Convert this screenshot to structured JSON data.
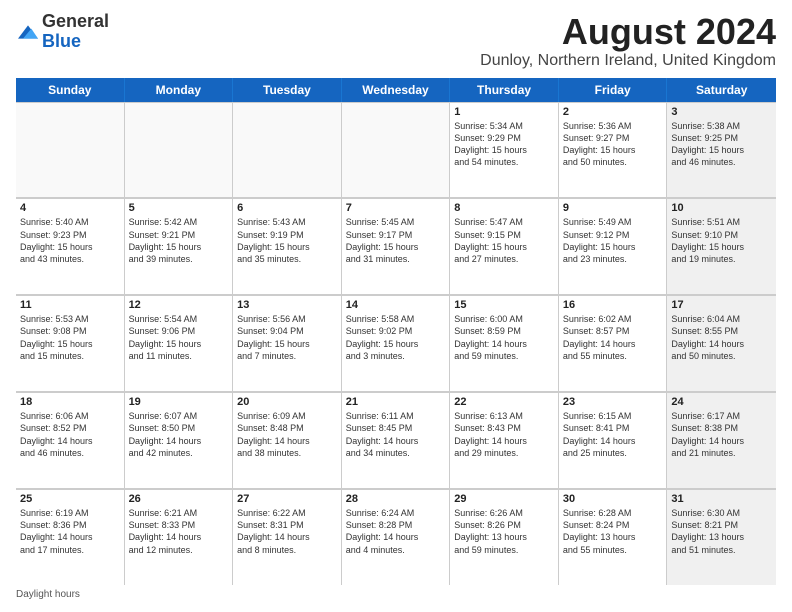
{
  "header": {
    "logo_line1": "General",
    "logo_line2": "Blue",
    "title": "August 2024",
    "subtitle": "Dunloy, Northern Ireland, United Kingdom"
  },
  "days_of_week": [
    "Sunday",
    "Monday",
    "Tuesday",
    "Wednesday",
    "Thursday",
    "Friday",
    "Saturday"
  ],
  "rows": [
    {
      "cells": [
        {
          "day": "",
          "info": "",
          "empty": true
        },
        {
          "day": "",
          "info": "",
          "empty": true
        },
        {
          "day": "",
          "info": "",
          "empty": true
        },
        {
          "day": "",
          "info": "",
          "empty": true
        },
        {
          "day": "1",
          "info": "Sunrise: 5:34 AM\nSunset: 9:29 PM\nDaylight: 15 hours\nand 54 minutes.",
          "empty": false
        },
        {
          "day": "2",
          "info": "Sunrise: 5:36 AM\nSunset: 9:27 PM\nDaylight: 15 hours\nand 50 minutes.",
          "empty": false
        },
        {
          "day": "3",
          "info": "Sunrise: 5:38 AM\nSunset: 9:25 PM\nDaylight: 15 hours\nand 46 minutes.",
          "empty": false,
          "shaded": true
        }
      ]
    },
    {
      "cells": [
        {
          "day": "4",
          "info": "Sunrise: 5:40 AM\nSunset: 9:23 PM\nDaylight: 15 hours\nand 43 minutes.",
          "empty": false
        },
        {
          "day": "5",
          "info": "Sunrise: 5:42 AM\nSunset: 9:21 PM\nDaylight: 15 hours\nand 39 minutes.",
          "empty": false
        },
        {
          "day": "6",
          "info": "Sunrise: 5:43 AM\nSunset: 9:19 PM\nDaylight: 15 hours\nand 35 minutes.",
          "empty": false
        },
        {
          "day": "7",
          "info": "Sunrise: 5:45 AM\nSunset: 9:17 PM\nDaylight: 15 hours\nand 31 minutes.",
          "empty": false
        },
        {
          "day": "8",
          "info": "Sunrise: 5:47 AM\nSunset: 9:15 PM\nDaylight: 15 hours\nand 27 minutes.",
          "empty": false
        },
        {
          "day": "9",
          "info": "Sunrise: 5:49 AM\nSunset: 9:12 PM\nDaylight: 15 hours\nand 23 minutes.",
          "empty": false
        },
        {
          "day": "10",
          "info": "Sunrise: 5:51 AM\nSunset: 9:10 PM\nDaylight: 15 hours\nand 19 minutes.",
          "empty": false,
          "shaded": true
        }
      ]
    },
    {
      "cells": [
        {
          "day": "11",
          "info": "Sunrise: 5:53 AM\nSunset: 9:08 PM\nDaylight: 15 hours\nand 15 minutes.",
          "empty": false
        },
        {
          "day": "12",
          "info": "Sunrise: 5:54 AM\nSunset: 9:06 PM\nDaylight: 15 hours\nand 11 minutes.",
          "empty": false
        },
        {
          "day": "13",
          "info": "Sunrise: 5:56 AM\nSunset: 9:04 PM\nDaylight: 15 hours\nand 7 minutes.",
          "empty": false
        },
        {
          "day": "14",
          "info": "Sunrise: 5:58 AM\nSunset: 9:02 PM\nDaylight: 15 hours\nand 3 minutes.",
          "empty": false
        },
        {
          "day": "15",
          "info": "Sunrise: 6:00 AM\nSunset: 8:59 PM\nDaylight: 14 hours\nand 59 minutes.",
          "empty": false
        },
        {
          "day": "16",
          "info": "Sunrise: 6:02 AM\nSunset: 8:57 PM\nDaylight: 14 hours\nand 55 minutes.",
          "empty": false
        },
        {
          "day": "17",
          "info": "Sunrise: 6:04 AM\nSunset: 8:55 PM\nDaylight: 14 hours\nand 50 minutes.",
          "empty": false,
          "shaded": true
        }
      ]
    },
    {
      "cells": [
        {
          "day": "18",
          "info": "Sunrise: 6:06 AM\nSunset: 8:52 PM\nDaylight: 14 hours\nand 46 minutes.",
          "empty": false
        },
        {
          "day": "19",
          "info": "Sunrise: 6:07 AM\nSunset: 8:50 PM\nDaylight: 14 hours\nand 42 minutes.",
          "empty": false
        },
        {
          "day": "20",
          "info": "Sunrise: 6:09 AM\nSunset: 8:48 PM\nDaylight: 14 hours\nand 38 minutes.",
          "empty": false
        },
        {
          "day": "21",
          "info": "Sunrise: 6:11 AM\nSunset: 8:45 PM\nDaylight: 14 hours\nand 34 minutes.",
          "empty": false
        },
        {
          "day": "22",
          "info": "Sunrise: 6:13 AM\nSunset: 8:43 PM\nDaylight: 14 hours\nand 29 minutes.",
          "empty": false
        },
        {
          "day": "23",
          "info": "Sunrise: 6:15 AM\nSunset: 8:41 PM\nDaylight: 14 hours\nand 25 minutes.",
          "empty": false
        },
        {
          "day": "24",
          "info": "Sunrise: 6:17 AM\nSunset: 8:38 PM\nDaylight: 14 hours\nand 21 minutes.",
          "empty": false,
          "shaded": true
        }
      ]
    },
    {
      "cells": [
        {
          "day": "25",
          "info": "Sunrise: 6:19 AM\nSunset: 8:36 PM\nDaylight: 14 hours\nand 17 minutes.",
          "empty": false
        },
        {
          "day": "26",
          "info": "Sunrise: 6:21 AM\nSunset: 8:33 PM\nDaylight: 14 hours\nand 12 minutes.",
          "empty": false
        },
        {
          "day": "27",
          "info": "Sunrise: 6:22 AM\nSunset: 8:31 PM\nDaylight: 14 hours\nand 8 minutes.",
          "empty": false
        },
        {
          "day": "28",
          "info": "Sunrise: 6:24 AM\nSunset: 8:28 PM\nDaylight: 14 hours\nand 4 minutes.",
          "empty": false
        },
        {
          "day": "29",
          "info": "Sunrise: 6:26 AM\nSunset: 8:26 PM\nDaylight: 13 hours\nand 59 minutes.",
          "empty": false
        },
        {
          "day": "30",
          "info": "Sunrise: 6:28 AM\nSunset: 8:24 PM\nDaylight: 13 hours\nand 55 minutes.",
          "empty": false
        },
        {
          "day": "31",
          "info": "Sunrise: 6:30 AM\nSunset: 8:21 PM\nDaylight: 13 hours\nand 51 minutes.",
          "empty": false,
          "shaded": true
        }
      ]
    }
  ],
  "footer": {
    "note": "Daylight hours"
  }
}
